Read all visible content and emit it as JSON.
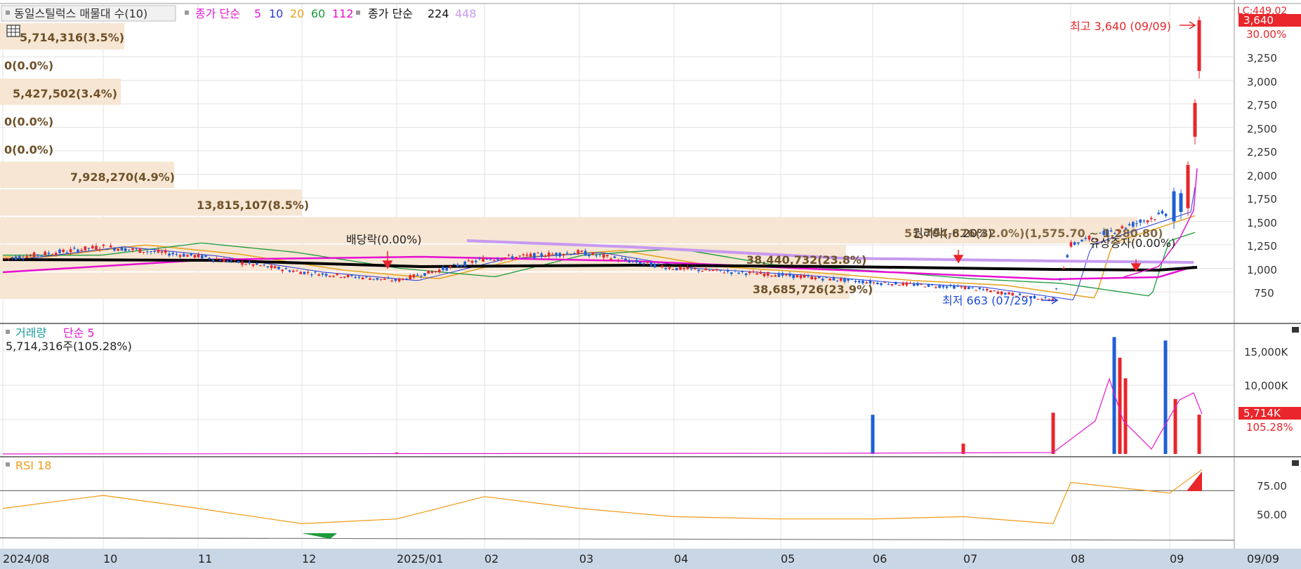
{
  "colors": {
    "up": "#e8262b",
    "down": "#1f5fd6",
    "ma5": "#e21ad0",
    "ma10": "#2a3bd6",
    "ma20": "#e6a21c",
    "ma60": "#1c9a3a",
    "ma112": "#e60fd2",
    "ma224": "#000000",
    "ma448": "#c79af0",
    "volume_ma": "#e21ad0",
    "rsi_line": "#f09a16",
    "profile_band": "#f6e6d3",
    "profile_text": "#6f5129",
    "grid": "#e3e3e3"
  },
  "price_panel": {
    "legend": {
      "title": "동일스틸럭스 매물대 수(10)",
      "ma_group1_label": "종가 단순",
      "ma_group1_periods": [
        "5",
        "10",
        "20",
        "60",
        "112"
      ],
      "ma_group2_label": "종가 단순",
      "ma_group2_periods": [
        "224",
        "448"
      ]
    },
    "corner_label": "LC:449.02",
    "last_price_badge": "3,640",
    "pct_label": "30.00%",
    "high_annotation": "최고 3,640 (09/09)",
    "low_annotation": "최저 663 (07/29)",
    "event_labels": [
      "배당락(0.00%)",
      "권리락(-6.20%)",
      "유상증자(0.00%)"
    ],
    "profile_labels": [
      "5,714,316(3.5%)",
      "0(0.0%)",
      "5,427,502(3.4%)",
      "0(0.0%)",
      "0(0.0%)",
      "7,928,270(4.9%)",
      "13,815,107(8.5%)",
      "51,704,876(32.0%)(1,575.70 ~ 1,280.80)",
      "38,440,732(23.8%)",
      "38,685,726(23.9%)"
    ],
    "y_ticks": [
      "3,250",
      "3,000",
      "2,750",
      "2,500",
      "2,250",
      "2,000",
      "1,750",
      "1,500",
      "1,250",
      "1,000",
      "750"
    ]
  },
  "volume_panel": {
    "legend_label": "거래량",
    "ma_label": "단순 5",
    "value_label": "5,714,316주(105.28%)",
    "badge": "5,714K",
    "badge_pct": "105.28%",
    "y_ticks": [
      "15,000K",
      "10,000K",
      "5,000K"
    ]
  },
  "rsi_panel": {
    "legend_label": "RSI 18",
    "y_ticks": [
      "75.00",
      "50.00"
    ]
  },
  "x_axis": {
    "labels": [
      "2024/08",
      "10",
      "11",
      "12",
      "2025/01",
      "02",
      "03",
      "04",
      "05",
      "06",
      "07",
      "08",
      "09"
    ],
    "current_label": "09/09"
  },
  "chart_data": [
    {
      "type": "candlestick",
      "title": "동일스틸럭스 매물대 수(10)",
      "date_range": [
        "2024/08",
        "2025/09/09"
      ],
      "y_range": [
        520,
        3650
      ],
      "price_path_approx": [
        {
          "x": "2024/08",
          "y": 1100
        },
        {
          "x": "10",
          "y": 1230
        },
        {
          "x": "11",
          "y": 1130
        },
        {
          "x": "12",
          "y": 960
        },
        {
          "x": "2025/01",
          "y": 870
        },
        {
          "x": "02",
          "y": 1100
        },
        {
          "x": "03",
          "y": 1170
        },
        {
          "x": "04",
          "y": 1000
        },
        {
          "x": "05",
          "y": 930
        },
        {
          "x": "06",
          "y": 850
        },
        {
          "x": "07",
          "y": 800
        },
        {
          "x": "07/29",
          "y": 663
        },
        {
          "x": "08",
          "y": 1250
        },
        {
          "x": "09",
          "y": 1600
        },
        {
          "x": "09/09",
          "y": 3640
        }
      ],
      "high": {
        "date": "09/09",
        "value": 3640
      },
      "low": {
        "date": "07/29",
        "value": 663
      },
      "volume_profile": [
        {
          "label": "5,714,316(3.5%)",
          "pct": 3.5
        },
        {
          "label": "0(0.0%)",
          "pct": 0.0
        },
        {
          "label": "5,427,502(3.4%)",
          "pct": 3.4
        },
        {
          "label": "0(0.0%)",
          "pct": 0.0
        },
        {
          "label": "0(0.0%)",
          "pct": 0.0
        },
        {
          "label": "7,928,270(4.9%)",
          "pct": 4.9
        },
        {
          "label": "13,815,107(8.5%)",
          "pct": 8.5
        },
        {
          "label": "51,704,876(32.0%)",
          "pct": 32.0
        },
        {
          "label": "38,440,732(23.8%)",
          "pct": 23.8
        },
        {
          "label": "38,685,726(23.9%)",
          "pct": 23.9
        }
      ]
    },
    {
      "type": "bar",
      "title": "거래량",
      "y_range": [
        0,
        19000
      ],
      "last_value_k": 5714,
      "bars": [
        {
          "x": "2025/01",
          "value_k": 200
        },
        {
          "x": "06",
          "value_k": 5700
        },
        {
          "x": "07",
          "value_k": 1500
        },
        {
          "x": "07/29",
          "value_k": 6000
        },
        {
          "x": "08",
          "value_k": 17000
        },
        {
          "x": "08",
          "value_k": 14000
        },
        {
          "x": "08",
          "value_k": 11000
        },
        {
          "x": "09",
          "value_k": 16500
        },
        {
          "x": "09",
          "value_k": 8000
        },
        {
          "x": "09/09",
          "value_k": 5714
        }
      ]
    },
    {
      "type": "line",
      "title": "RSI 18",
      "y_range": [
        40,
        90
      ],
      "series": [
        {
          "name": "RSI 18",
          "points": [
            {
              "x": "2024/08",
              "y": 55
            },
            {
              "x": "10",
              "y": 66
            },
            {
              "x": "11",
              "y": 55
            },
            {
              "x": "12",
              "y": 42
            },
            {
              "x": "2025/01",
              "y": 46
            },
            {
              "x": "02",
              "y": 65
            },
            {
              "x": "03",
              "y": 55
            },
            {
              "x": "04",
              "y": 48
            },
            {
              "x": "05",
              "y": 46
            },
            {
              "x": "06",
              "y": 46
            },
            {
              "x": "07",
              "y": 48
            },
            {
              "x": "07/29",
              "y": 42
            },
            {
              "x": "08",
              "y": 77
            },
            {
              "x": "09",
              "y": 68
            },
            {
              "x": "09/09",
              "y": 88
            }
          ]
        }
      ]
    }
  ]
}
